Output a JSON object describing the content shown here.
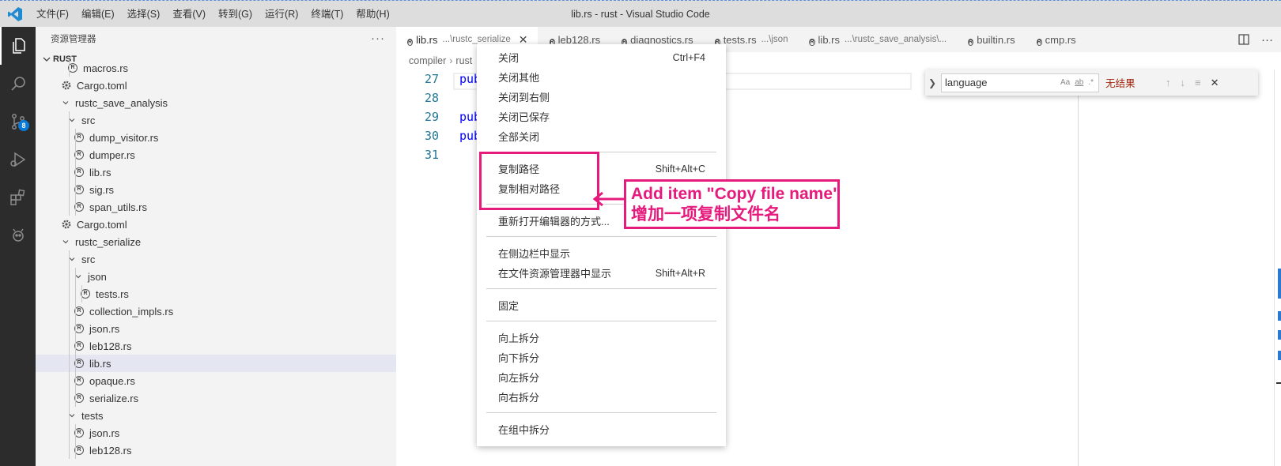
{
  "titlebar": {
    "menus": [
      "文件(F)",
      "编辑(E)",
      "选择(S)",
      "查看(V)",
      "转到(G)",
      "运行(R)",
      "终端(T)",
      "帮助(H)"
    ],
    "title": "lib.rs - rust - Visual Studio Code"
  },
  "activitybar": {
    "scm_badge": "8"
  },
  "sidebar": {
    "header": "资源管理器",
    "more": "···",
    "section": "RUST",
    "tree": [
      {
        "label": "macros.rs",
        "indent": 2,
        "type": "rs"
      },
      {
        "label": "Cargo.toml",
        "indent": 1,
        "type": "gear"
      },
      {
        "label": "rustc_save_analysis",
        "indent": 1,
        "type": "folder"
      },
      {
        "label": "src",
        "indent": 2,
        "type": "folder"
      },
      {
        "label": "dump_visitor.rs",
        "indent": 3,
        "type": "rs"
      },
      {
        "label": "dumper.rs",
        "indent": 3,
        "type": "rs"
      },
      {
        "label": "lib.rs",
        "indent": 3,
        "type": "rs"
      },
      {
        "label": "sig.rs",
        "indent": 3,
        "type": "rs"
      },
      {
        "label": "span_utils.rs",
        "indent": 3,
        "type": "rs"
      },
      {
        "label": "Cargo.toml",
        "indent": 1,
        "type": "gear"
      },
      {
        "label": "rustc_serialize",
        "indent": 1,
        "type": "folder"
      },
      {
        "label": "src",
        "indent": 2,
        "type": "folder"
      },
      {
        "label": "json",
        "indent": 3,
        "type": "folder"
      },
      {
        "label": "tests.rs",
        "indent": 4,
        "type": "rs"
      },
      {
        "label": "collection_impls.rs",
        "indent": 3,
        "type": "rs"
      },
      {
        "label": "json.rs",
        "indent": 3,
        "type": "rs"
      },
      {
        "label": "leb128.rs",
        "indent": 3,
        "type": "rs"
      },
      {
        "label": "lib.rs",
        "indent": 3,
        "type": "rs",
        "selected": true
      },
      {
        "label": "opaque.rs",
        "indent": 3,
        "type": "rs"
      },
      {
        "label": "serialize.rs",
        "indent": 3,
        "type": "rs"
      },
      {
        "label": "tests",
        "indent": 2,
        "type": "folder"
      },
      {
        "label": "json.rs",
        "indent": 3,
        "type": "rs"
      },
      {
        "label": "leb128.rs",
        "indent": 3,
        "type": "rs"
      }
    ]
  },
  "tabs": [
    {
      "name": "lib.rs",
      "desc": "...\\rustc_serialize",
      "active": true
    },
    {
      "name": "leb128.rs",
      "desc": ""
    },
    {
      "name": "diagnostics.rs",
      "desc": ""
    },
    {
      "name": "tests.rs",
      "desc": "...\\json"
    },
    {
      "name": "lib.rs",
      "desc": "...\\rustc_save_analysis\\..."
    },
    {
      "name": "builtin.rs",
      "desc": ""
    },
    {
      "name": "cmp.rs",
      "desc": ""
    }
  ],
  "breadcrumb": [
    "compiler",
    "rust"
  ],
  "code": [
    {
      "line": "27",
      "text": "pub"
    },
    {
      "line": "28",
      "text": ""
    },
    {
      "line": "29",
      "text": "pub"
    },
    {
      "line": "30",
      "text": "pub"
    },
    {
      "line": "31",
      "text": ""
    }
  ],
  "find": {
    "value": "language",
    "opt_case": "Aa",
    "opt_word": "ab",
    "opt_regex": ".*",
    "result": "无结果"
  },
  "context_menu": {
    "groups": [
      [
        {
          "label": "关闭",
          "kb": "Ctrl+F4"
        },
        {
          "label": "关闭其他",
          "kb": ""
        },
        {
          "label": "关闭到右侧",
          "kb": ""
        },
        {
          "label": "关闭已保存",
          "kb": ""
        },
        {
          "label": "全部关闭",
          "kb": ""
        }
      ],
      [
        {
          "label": "复制路径",
          "kb": "Shift+Alt+C"
        },
        {
          "label": "复制相对路径",
          "kb": ""
        }
      ],
      [
        {
          "label": "重新打开编辑器的方式...",
          "kb": ""
        }
      ],
      [
        {
          "label": "在侧边栏中显示",
          "kb": ""
        },
        {
          "label": "在文件资源管理器中显示",
          "kb": "Shift+Alt+R"
        }
      ],
      [
        {
          "label": "固定",
          "kb": ""
        }
      ],
      [
        {
          "label": "向上拆分",
          "kb": ""
        },
        {
          "label": "向下拆分",
          "kb": ""
        },
        {
          "label": "向左拆分",
          "kb": ""
        },
        {
          "label": "向右拆分",
          "kb": ""
        }
      ],
      [
        {
          "label": "在组中拆分",
          "kb": ""
        }
      ]
    ]
  },
  "annotation": {
    "line1": "Add item \"Copy file name\"",
    "line2": "增加一项复制文件名",
    "color": "#e6197c"
  }
}
